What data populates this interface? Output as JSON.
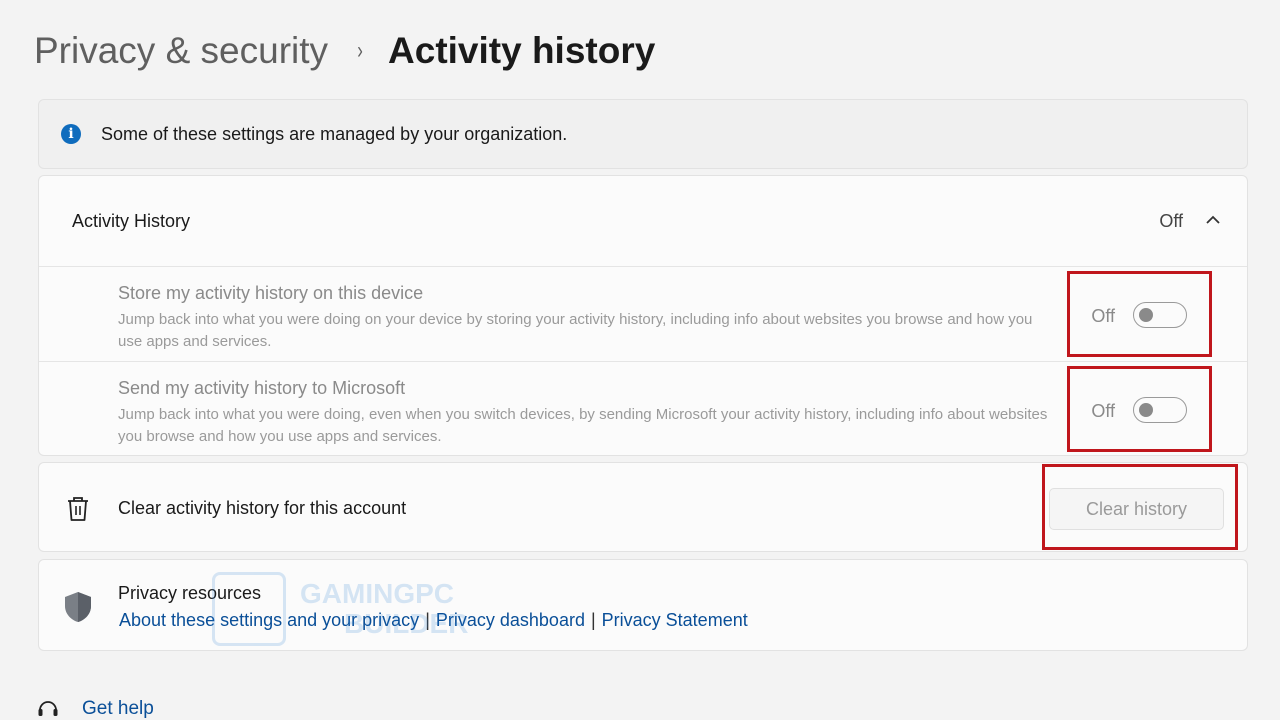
{
  "breadcrumb": {
    "parent": "Privacy & security",
    "separator": "›",
    "current": "Activity history"
  },
  "info_banner": {
    "icon": "info-icon",
    "text": "Some of these settings are managed by your organization."
  },
  "activity_history": {
    "title": "Activity History",
    "state": "Off",
    "expanded": true,
    "items": [
      {
        "title": "Store my activity history on this device",
        "description": "Jump back into what you were doing on your device by storing your activity history, including info about websites you browse and how you use apps and services.",
        "toggle_label": "Off",
        "toggle_on": false
      },
      {
        "title": "Send my activity history to Microsoft",
        "description": "Jump back into what you were doing, even when you switch devices, by sending Microsoft your activity history, including info about websites you browse and how you use apps and services.",
        "toggle_label": "Off",
        "toggle_on": false
      }
    ]
  },
  "clear_history": {
    "icon": "trash-icon",
    "label": "Clear activity history for this account",
    "button_label": "Clear history",
    "button_disabled": true
  },
  "privacy_resources": {
    "icon": "shield-icon",
    "title": "Privacy resources",
    "links": [
      "About these settings and your privacy",
      "Privacy dashboard",
      "Privacy Statement"
    ],
    "link_separator": "|"
  },
  "help": {
    "icon": "help-icon",
    "label": "Get help"
  },
  "watermark": {
    "line1": "GAMINGPC",
    "line2": "BUILDER"
  },
  "colors": {
    "accent": "#0f6cbd",
    "link": "#0a4f98",
    "highlight": "#c0161c",
    "background": "#f3f3f3"
  }
}
